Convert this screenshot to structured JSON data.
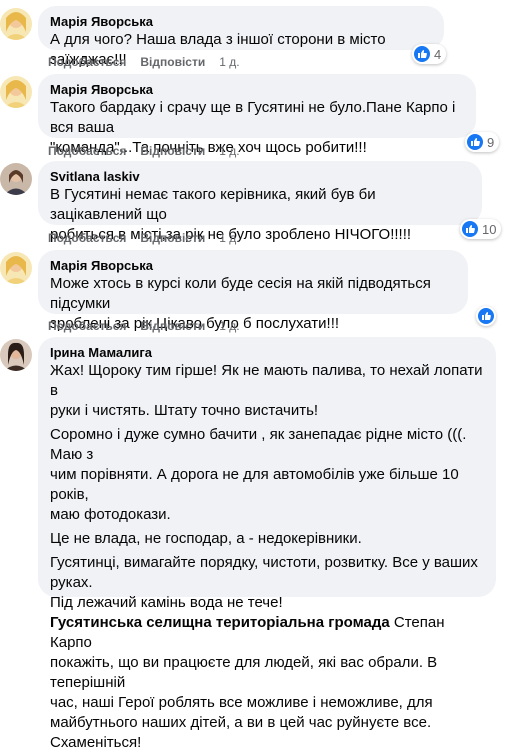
{
  "labels": {
    "like": "Подобається",
    "reply": "Відповісти"
  },
  "colors": {
    "like_blue": "#1877f2",
    "bubble_bg": "#f0f2f5",
    "meta_gray": "#65676b"
  },
  "comments": [
    {
      "author": "Марія Яворська",
      "avatar_icon": "user-avatar-yellow-icon",
      "lines": [
        "А для чого? Наша влада з іншої сторони в місто заїжджає!!!"
      ],
      "time": "1 д.",
      "reactions": "4"
    },
    {
      "author": "Марія Яворська",
      "avatar_icon": "user-avatar-yellow-icon",
      "lines": [
        "Такого бардаку і срачу ще в Гусятині не було.Пане Карпо і вся ваша",
        "\"команда\"...Та почніть вже хоч щось робити!!!"
      ],
      "time": "1 д.",
      "reactions": "9"
    },
    {
      "author": "Svitlana laskiv",
      "avatar_icon": "user-avatar-photo-icon",
      "lines": [
        "В Гусятині немає такого керівника, який був би зацікавлений що",
        "робиться в місті,за рік не було зроблено НІЧОГО!!!!!"
      ],
      "time": "1 д.",
      "reactions": "10"
    },
    {
      "author": "Марія Яворська",
      "avatar_icon": "user-avatar-yellow-icon",
      "lines": [
        "Може хтось в курсі коли буде сесія на якій підводяться підсумки",
        "зроблені за рік.Цікаво було б послухати!!!"
      ],
      "time": "1 д.",
      "reactions": ""
    },
    {
      "author": "Ірина Мамалига",
      "avatar_icon": "user-avatar-dark-icon",
      "paragraphs": [
        [
          "Жах! Щороку тим гірше! Як не мають палива, то нехай лопати в",
          "руки і чистять. Штату точно вистачить!"
        ],
        [
          "Соромно і дуже сумно бачити , як занепадає рідне місто (((. Маю з",
          "чим порівняти. А дорога не для автомобілів уже більше 10 років,",
          "маю фотодокази."
        ],
        [
          "Це не влада, не господар, а - недокерівники."
        ],
        [
          "Гусятинці, вимагайте порядку, чистоти, розвитку. Все у ваших руках.",
          "Під лежачий камінь вода не тече!"
        ]
      ],
      "mention1": "Гусятинська селищна територіальна громада",
      "mention1_after": " Степан Карпо",
      "final_lines": [
        "покажіть, що ви працюєте для людей, які вас обрали. В теперішній",
        "час, наші Герої роблять все можливе і неможливе, для",
        "майбутнього наших дітей, а ви в цей час руйнуєте все. Схаменіться!"
      ]
    }
  ]
}
